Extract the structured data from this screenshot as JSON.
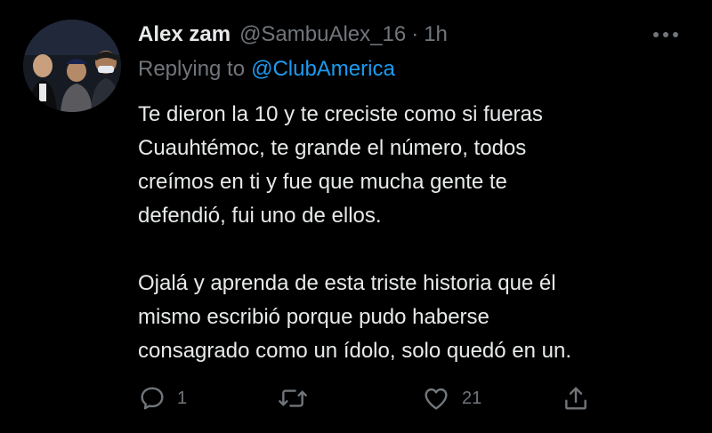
{
  "tweet": {
    "author_name": "Alex zam",
    "author_handle": "@SambuAlex_16",
    "separator": "·",
    "time": "1h",
    "replying_prefix": "Replying to",
    "replying_to": "@ClubAmerica",
    "paragraphs": [
      [
        "Te dieron la 10 y te creciste como si fueras",
        "Cuauhtémoc, te grande el número, todos",
        "creímos en ti y fue que mucha gente te",
        "defendió, fui uno de ellos."
      ],
      [
        "Ojalá y aprenda de esta triste historia que él",
        "mismo escribió porque pudo haberse",
        "consagrado como un ídolo, solo quedó en un."
      ]
    ],
    "actions": {
      "reply_count": "1",
      "retweet_count": "",
      "like_count": "21"
    }
  },
  "icons": {
    "more": "more-horizontal-icon",
    "reply": "comment-bubble-icon",
    "retweet": "retweet-icon",
    "like": "heart-icon",
    "share": "share-icon"
  },
  "colors": {
    "background": "#000000",
    "text": "#e7e9ea",
    "muted": "#71767b",
    "link": "#1d9bf0"
  }
}
